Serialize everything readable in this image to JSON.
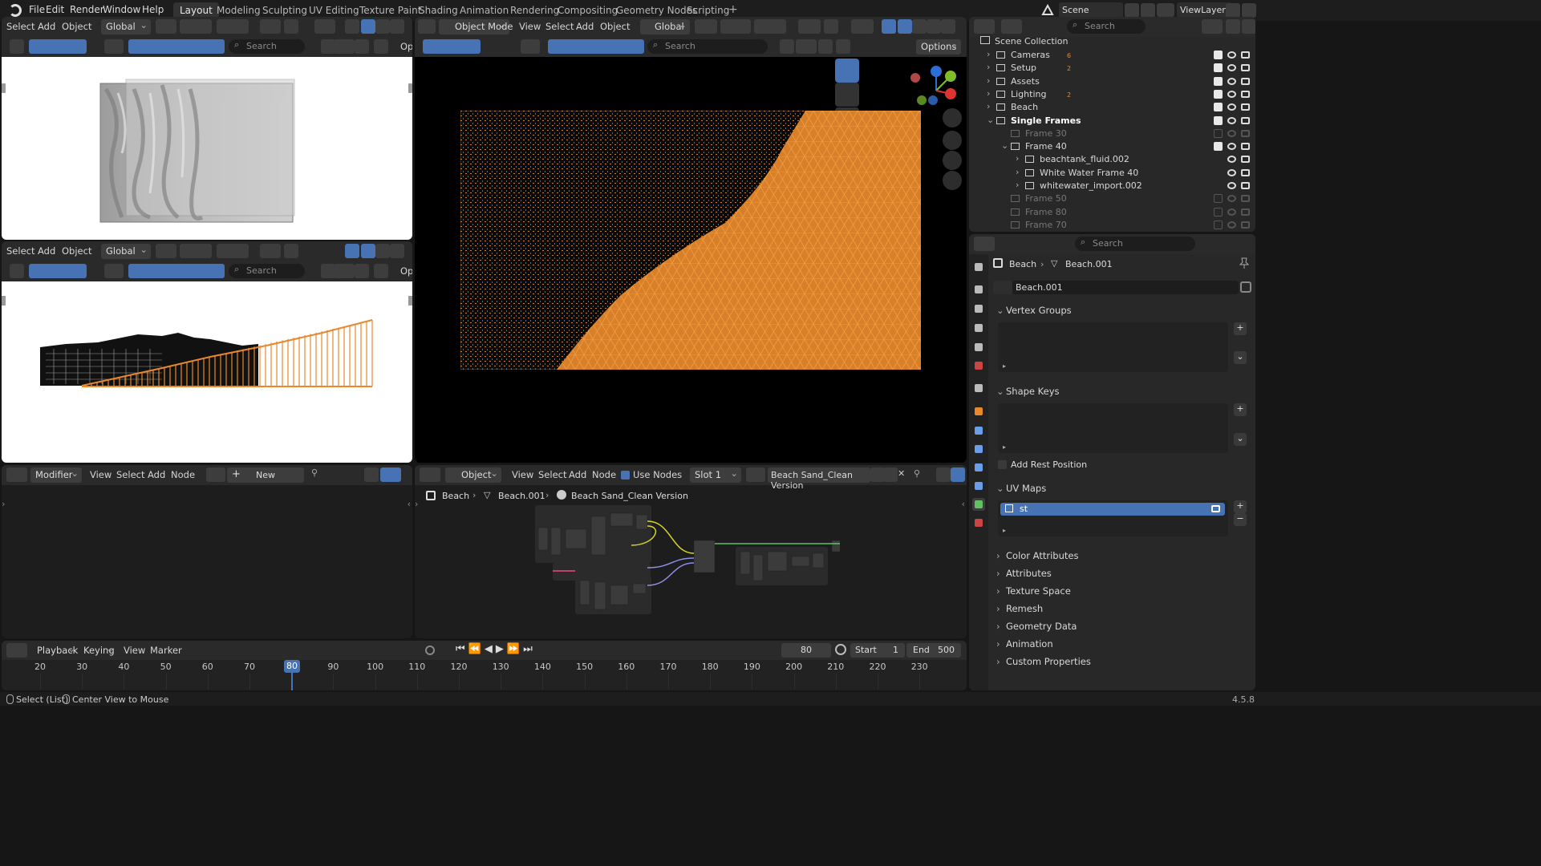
{
  "topbar": {
    "menus": [
      "File",
      "Edit",
      "Render",
      "Window",
      "Help"
    ],
    "workspaces": [
      "Layout",
      "Modeling",
      "Sculpting",
      "UV Editing",
      "Texture Paint",
      "Shading",
      "Animation",
      "Rendering",
      "Compositing",
      "Geometry Nodes",
      "Scripting"
    ],
    "add_tab": "+",
    "scene": "Scene",
    "view_layer": "ViewLayer"
  },
  "viewport_top": {
    "menus": [
      "Select",
      "Add",
      "Object"
    ],
    "orientation": "Global",
    "search_placeholder": "Search",
    "options_clip": "Op"
  },
  "viewport_mid": {
    "menus": [
      "Select",
      "Add",
      "Object"
    ],
    "orientation": "Global",
    "search_placeholder": "Search",
    "options_clip": "Op"
  },
  "viewport_main": {
    "mode": "Object Mode",
    "menus": [
      "View",
      "Select",
      "Add",
      "Object"
    ],
    "orientation": "Global",
    "search_placeholder": "Search",
    "options": "Options"
  },
  "outliner": {
    "search_placeholder": "Search",
    "root": "Scene Collection",
    "collections": [
      {
        "label": "Cameras",
        "badge": "6",
        "enabled": true
      },
      {
        "label": "Setup",
        "badge": "2",
        "enabled": true
      },
      {
        "label": "Assets",
        "badge": "",
        "enabled": true
      },
      {
        "label": "Lighting",
        "badge": "2",
        "enabled": true
      },
      {
        "label": "Beach",
        "badge": "",
        "enabled": true
      },
      {
        "label": "Single Frames",
        "badge": "",
        "enabled": true
      },
      {
        "label": "Frame 30",
        "badge": "",
        "enabled": false
      },
      {
        "label": "Frame 40",
        "badge": "",
        "enabled": true
      },
      {
        "label": "beachtank_fluid.002",
        "badge": "",
        "enabled": true
      },
      {
        "label": "White Water Frame 40",
        "badge": "",
        "enabled": true
      },
      {
        "label": "whitewater_import.002",
        "badge": "",
        "enabled": true
      },
      {
        "label": "Frame 50",
        "badge": "",
        "enabled": false
      },
      {
        "label": "Frame 80",
        "badge": "",
        "enabled": false
      },
      {
        "label": "Frame 70",
        "badge": "",
        "enabled": false
      }
    ]
  },
  "properties": {
    "search_placeholder": "Search",
    "breadcrumb_object": "Beach",
    "breadcrumb_data": "Beach.001",
    "data_name": "Beach.001",
    "panels": [
      "Vertex Groups",
      "Shape Keys",
      "UV Maps",
      "Color Attributes",
      "Attributes",
      "Texture Space",
      "Remesh",
      "Geometry Data",
      "Animation",
      "Custom Properties"
    ],
    "add_rest_position": "Add Rest Position",
    "uv_map_item": "st"
  },
  "modifier_editor": {
    "mode": "Modifier",
    "menus": [
      "View",
      "Select",
      "Add",
      "Node"
    ],
    "new_button": "New"
  },
  "shader_editor": {
    "type": "Object",
    "menus": [
      "View",
      "Select",
      "Add",
      "Node"
    ],
    "use_nodes": "Use Nodes",
    "slot": "Slot 1",
    "material": "Beach Sand_Clean Version",
    "breadcrumb": [
      "Beach",
      "Beach.001",
      "Beach Sand_Clean Version"
    ]
  },
  "timeline": {
    "menus": [
      "Playback",
      "Keying",
      "View",
      "Marker"
    ],
    "current_frame": "80",
    "start_label": "Start",
    "start": "1",
    "end_label": "End",
    "end": "500",
    "ticks": [
      "20",
      "30",
      "40",
      "50",
      "60",
      "70",
      "80",
      "90",
      "100",
      "110",
      "120",
      "130",
      "140",
      "150",
      "160",
      "170",
      "180",
      "190",
      "200",
      "210",
      "220",
      "230"
    ]
  },
  "statusbar": {
    "hint1": "Select (List)",
    "hint2": "Center View to Mouse",
    "version": "4.5.8"
  },
  "colors": {
    "accent": "#4772b3",
    "wire": "#e8892e",
    "bg": "#282828"
  }
}
